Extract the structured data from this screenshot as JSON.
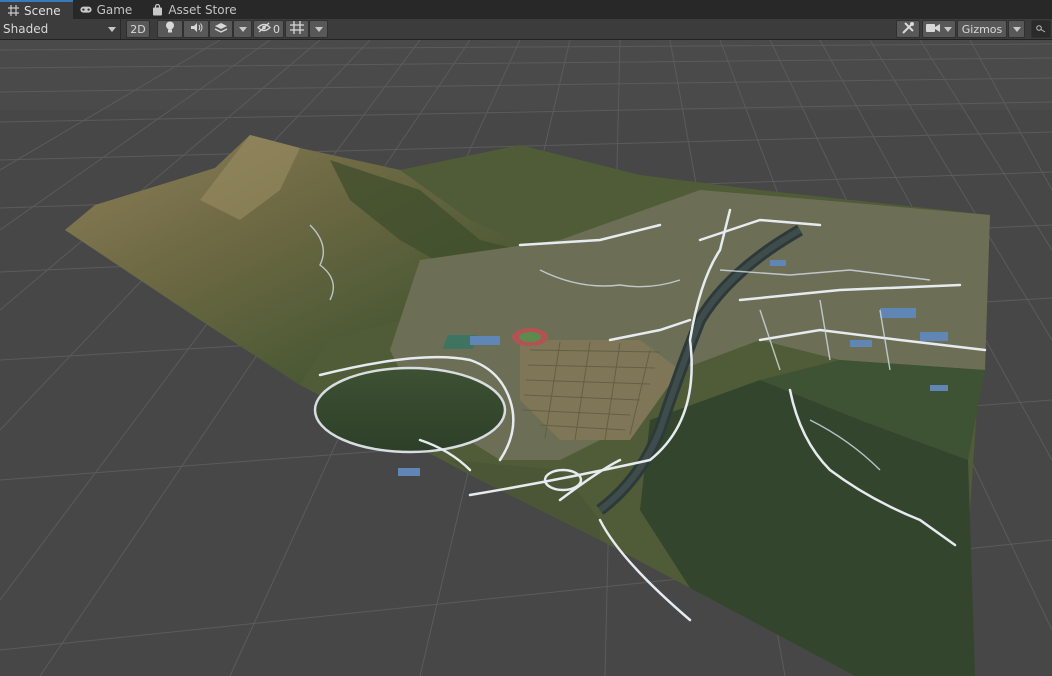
{
  "tabs": [
    {
      "label": "Scene",
      "icon": "grid-icon",
      "active": true
    },
    {
      "label": "Game",
      "icon": "gamepad-icon",
      "active": false
    },
    {
      "label": "Asset Store",
      "icon": "shopping-bag-icon",
      "active": false
    }
  ],
  "toolbar": {
    "shading_mode": "Shaded",
    "mode_2d_label": "2D",
    "hidden_count": "0",
    "gizmos_label": "Gizmos"
  },
  "colors": {
    "tab_accent": "#3a79bb",
    "toolbar_bg": "#3c3c3c",
    "scene_bg": "#474747",
    "grid_line": "#5a5a5a"
  }
}
